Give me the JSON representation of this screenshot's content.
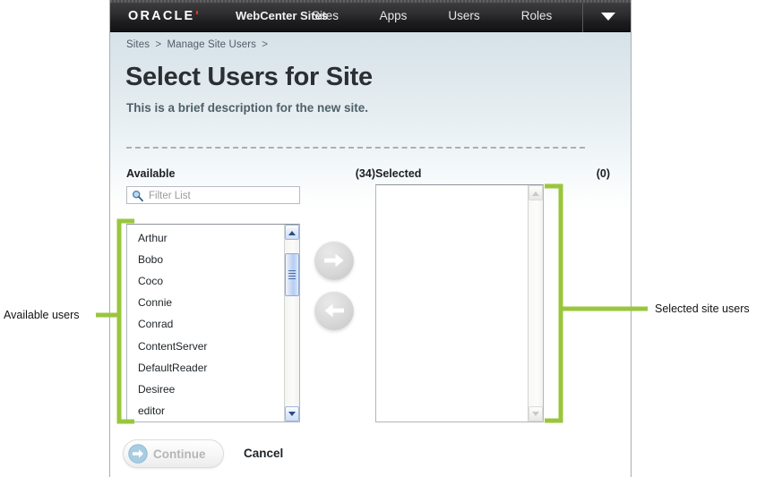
{
  "topnav": {
    "oracle_logo": "ORACLE",
    "product": "WebCenter Sites",
    "items": [
      {
        "id": "sites",
        "label": "Sites"
      },
      {
        "id": "apps",
        "label": "Apps"
      },
      {
        "id": "users",
        "label": "Users"
      },
      {
        "id": "roles",
        "label": "Roles"
      }
    ],
    "menu_icon": "chevron-down-icon"
  },
  "breadcrumb": {
    "items": [
      "Sites",
      "Manage Site Users"
    ],
    "separator": ">",
    "trailing_separator": ">"
  },
  "page": {
    "title": "Select Users for Site",
    "description": "This is a brief description for the new site."
  },
  "available": {
    "label": "Available",
    "count": "(34)",
    "filter": {
      "placeholder": "Filter List",
      "value": "",
      "icon": "search-icon"
    },
    "items": [
      "Arthur",
      "Bobo",
      "Coco",
      "Connie",
      "Conrad",
      "ContentServer",
      "DefaultReader",
      "Desiree",
      "editor"
    ],
    "scrollbar": {
      "enabled": true,
      "thumb_top_pct": 8,
      "thumb_height_pct": 26
    }
  },
  "selected": {
    "label": "Selected",
    "count": "(0)",
    "items": [],
    "scrollbar": {
      "enabled": false
    }
  },
  "transfer": {
    "add_icon": "arrow-right-icon",
    "remove_icon": "arrow-left-icon"
  },
  "footer": {
    "continue_label": "Continue",
    "continue_icon": "arrow-right-circle-icon",
    "continue_disabled": true,
    "cancel_label": "Cancel"
  },
  "annotations": {
    "left_label": "Available users",
    "right_label": "Selected site users",
    "color": "#9ac63c"
  },
  "colors": {
    "annotation_green": "#9ac63c",
    "nav_bar_dark": "#2b2b2d",
    "panel_gradient_top": "#d6e2e8",
    "panel_gradient_bottom": "#ffffff",
    "title_text": "#2b2f33",
    "description_text": "#4e6069",
    "scrollbar_blue": "#b9cdf1",
    "continue_icon_blue": "#a8cde2"
  }
}
